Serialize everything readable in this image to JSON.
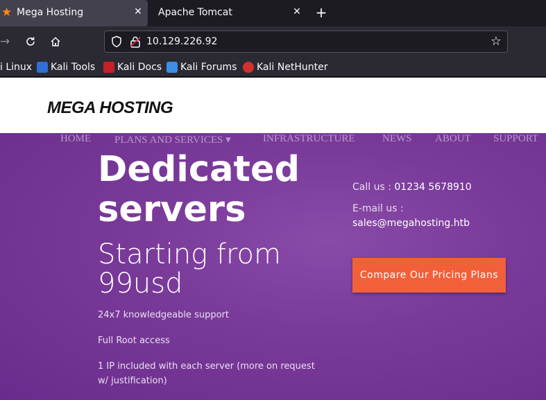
{
  "browser": {
    "tabs": [
      {
        "title": "Mega Hosting",
        "active": true
      },
      {
        "title": "Apache Tomcat",
        "active": false
      }
    ],
    "url": "10.129.226.92",
    "bookmarks": [
      {
        "label": "i Linux"
      },
      {
        "label": "Kali Tools"
      },
      {
        "label": "Kali Docs"
      },
      {
        "label": "Kali Forums"
      },
      {
        "label": "Kali NetHunter"
      }
    ]
  },
  "site": {
    "logo": "MEGA HOSTING",
    "nav": [
      "HOME",
      "PLANS AND SERVICES ▾",
      "INFRASTRUCTURE",
      "NEWS",
      "ABOUT",
      "SUPPORT"
    ],
    "hero": {
      "title": "Dedicated servers",
      "subtitle": "Starting from 99usd",
      "features": [
        "24x7 knowledgeable support",
        "Full Root access",
        "1 IP included with each server (more on request w/ justification)"
      ],
      "call_label": "Call us :",
      "call_value": "01234 5678910",
      "email_label": "E-mail us :",
      "email_value": "sales@megahosting.htb",
      "cta": "Compare Our Pricing Plans"
    }
  },
  "colors": {
    "accent": "#f2603a",
    "hero_bg": "#7a3a9a"
  }
}
